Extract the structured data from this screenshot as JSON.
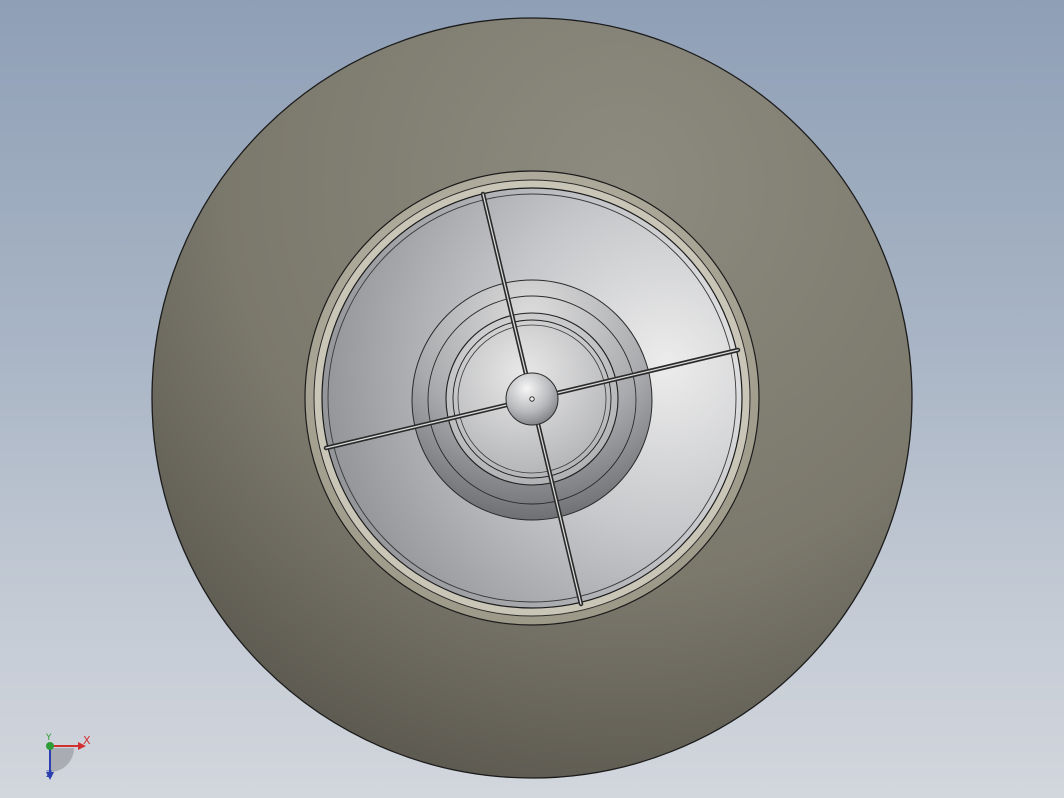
{
  "viewport": {
    "background_top": "#8f9fb6",
    "background_bottom": "#d2d6dd"
  },
  "model": {
    "outer_ring_color": "#7d7a6e",
    "inner_disc_color": "#c4c5c8",
    "edge_color": "#1b1b1b"
  },
  "triad": {
    "x_label": "X",
    "y_label": "Y",
    "z_label": "Z",
    "x_color": "#d23030",
    "y_color": "#2e9c34",
    "z_color": "#2b3fb0"
  }
}
